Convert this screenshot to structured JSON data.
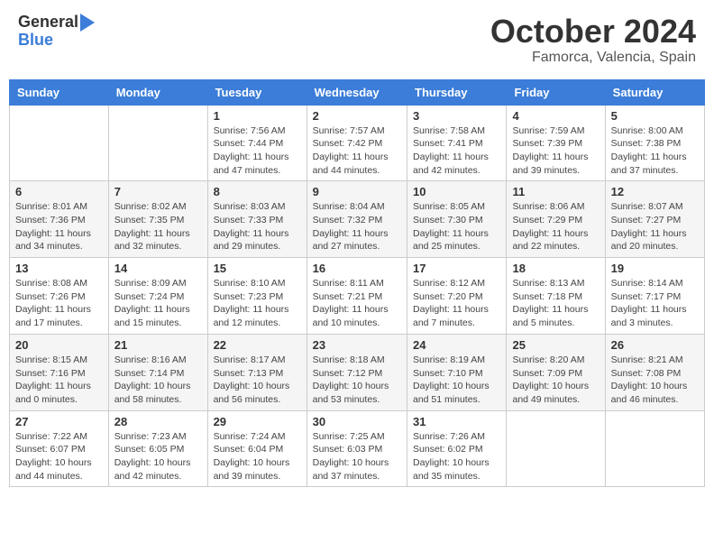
{
  "header": {
    "logo_text_general": "General",
    "logo_text_blue": "Blue",
    "month_title": "October 2024",
    "location": "Famorca, Valencia, Spain"
  },
  "days_of_week": [
    "Sunday",
    "Monday",
    "Tuesday",
    "Wednesday",
    "Thursday",
    "Friday",
    "Saturday"
  ],
  "weeks": [
    [
      {
        "day": "",
        "info": ""
      },
      {
        "day": "",
        "info": ""
      },
      {
        "day": "1",
        "info": "Sunrise: 7:56 AM\nSunset: 7:44 PM\nDaylight: 11 hours and 47 minutes."
      },
      {
        "day": "2",
        "info": "Sunrise: 7:57 AM\nSunset: 7:42 PM\nDaylight: 11 hours and 44 minutes."
      },
      {
        "day": "3",
        "info": "Sunrise: 7:58 AM\nSunset: 7:41 PM\nDaylight: 11 hours and 42 minutes."
      },
      {
        "day": "4",
        "info": "Sunrise: 7:59 AM\nSunset: 7:39 PM\nDaylight: 11 hours and 39 minutes."
      },
      {
        "day": "5",
        "info": "Sunrise: 8:00 AM\nSunset: 7:38 PM\nDaylight: 11 hours and 37 minutes."
      }
    ],
    [
      {
        "day": "6",
        "info": "Sunrise: 8:01 AM\nSunset: 7:36 PM\nDaylight: 11 hours and 34 minutes."
      },
      {
        "day": "7",
        "info": "Sunrise: 8:02 AM\nSunset: 7:35 PM\nDaylight: 11 hours and 32 minutes."
      },
      {
        "day": "8",
        "info": "Sunrise: 8:03 AM\nSunset: 7:33 PM\nDaylight: 11 hours and 29 minutes."
      },
      {
        "day": "9",
        "info": "Sunrise: 8:04 AM\nSunset: 7:32 PM\nDaylight: 11 hours and 27 minutes."
      },
      {
        "day": "10",
        "info": "Sunrise: 8:05 AM\nSunset: 7:30 PM\nDaylight: 11 hours and 25 minutes."
      },
      {
        "day": "11",
        "info": "Sunrise: 8:06 AM\nSunset: 7:29 PM\nDaylight: 11 hours and 22 minutes."
      },
      {
        "day": "12",
        "info": "Sunrise: 8:07 AM\nSunset: 7:27 PM\nDaylight: 11 hours and 20 minutes."
      }
    ],
    [
      {
        "day": "13",
        "info": "Sunrise: 8:08 AM\nSunset: 7:26 PM\nDaylight: 11 hours and 17 minutes."
      },
      {
        "day": "14",
        "info": "Sunrise: 8:09 AM\nSunset: 7:24 PM\nDaylight: 11 hours and 15 minutes."
      },
      {
        "day": "15",
        "info": "Sunrise: 8:10 AM\nSunset: 7:23 PM\nDaylight: 11 hours and 12 minutes."
      },
      {
        "day": "16",
        "info": "Sunrise: 8:11 AM\nSunset: 7:21 PM\nDaylight: 11 hours and 10 minutes."
      },
      {
        "day": "17",
        "info": "Sunrise: 8:12 AM\nSunset: 7:20 PM\nDaylight: 11 hours and 7 minutes."
      },
      {
        "day": "18",
        "info": "Sunrise: 8:13 AM\nSunset: 7:18 PM\nDaylight: 11 hours and 5 minutes."
      },
      {
        "day": "19",
        "info": "Sunrise: 8:14 AM\nSunset: 7:17 PM\nDaylight: 11 hours and 3 minutes."
      }
    ],
    [
      {
        "day": "20",
        "info": "Sunrise: 8:15 AM\nSunset: 7:16 PM\nDaylight: 11 hours and 0 minutes."
      },
      {
        "day": "21",
        "info": "Sunrise: 8:16 AM\nSunset: 7:14 PM\nDaylight: 10 hours and 58 minutes."
      },
      {
        "day": "22",
        "info": "Sunrise: 8:17 AM\nSunset: 7:13 PM\nDaylight: 10 hours and 56 minutes."
      },
      {
        "day": "23",
        "info": "Sunrise: 8:18 AM\nSunset: 7:12 PM\nDaylight: 10 hours and 53 minutes."
      },
      {
        "day": "24",
        "info": "Sunrise: 8:19 AM\nSunset: 7:10 PM\nDaylight: 10 hours and 51 minutes."
      },
      {
        "day": "25",
        "info": "Sunrise: 8:20 AM\nSunset: 7:09 PM\nDaylight: 10 hours and 49 minutes."
      },
      {
        "day": "26",
        "info": "Sunrise: 8:21 AM\nSunset: 7:08 PM\nDaylight: 10 hours and 46 minutes."
      }
    ],
    [
      {
        "day": "27",
        "info": "Sunrise: 7:22 AM\nSunset: 6:07 PM\nDaylight: 10 hours and 44 minutes."
      },
      {
        "day": "28",
        "info": "Sunrise: 7:23 AM\nSunset: 6:05 PM\nDaylight: 10 hours and 42 minutes."
      },
      {
        "day": "29",
        "info": "Sunrise: 7:24 AM\nSunset: 6:04 PM\nDaylight: 10 hours and 39 minutes."
      },
      {
        "day": "30",
        "info": "Sunrise: 7:25 AM\nSunset: 6:03 PM\nDaylight: 10 hours and 37 minutes."
      },
      {
        "day": "31",
        "info": "Sunrise: 7:26 AM\nSunset: 6:02 PM\nDaylight: 10 hours and 35 minutes."
      },
      {
        "day": "",
        "info": ""
      },
      {
        "day": "",
        "info": ""
      }
    ]
  ]
}
